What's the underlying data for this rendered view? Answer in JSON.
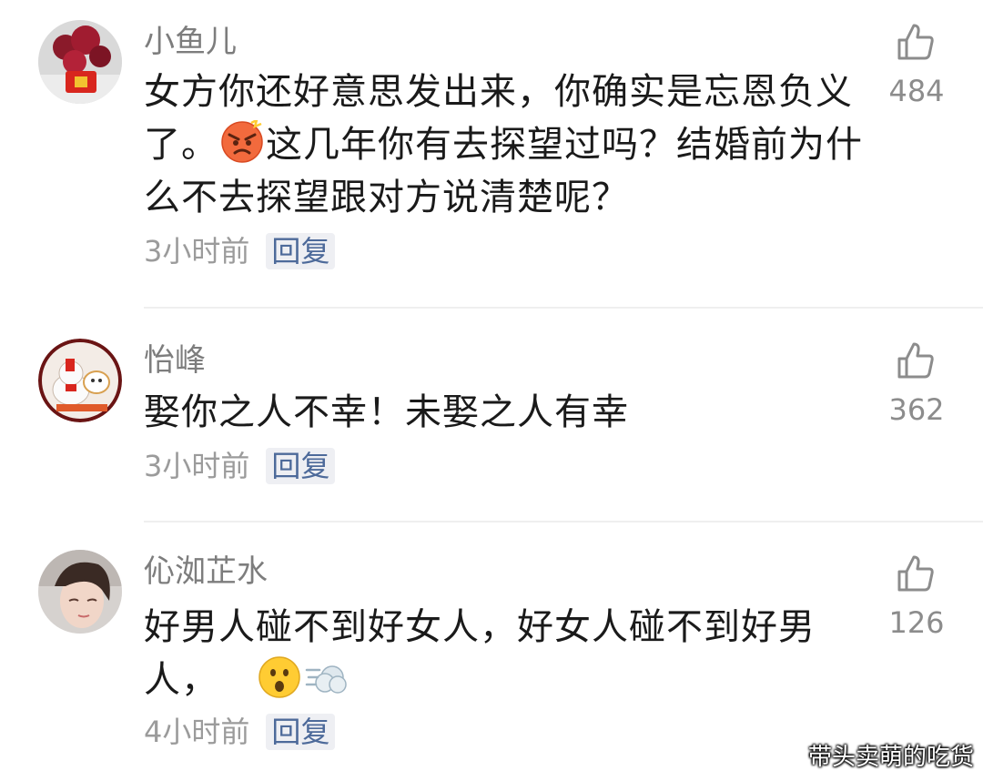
{
  "comments": [
    {
      "username": "小鱼儿",
      "content_a": "女方你还好意思发出来，你确实是忘恩负义了。",
      "emoji_a": "angry-face-emoji",
      "content_b": "这几年你有去探望过吗？结婚前为什么不去探望跟对方说清楚呢？",
      "time": "3小时前",
      "reply_label": "回复",
      "likes": "484"
    },
    {
      "username": "怡峰",
      "content_a": "娶你之人不幸！未娶之人有幸",
      "time": "3小时前",
      "reply_label": "回复",
      "likes": "362"
    },
    {
      "username": "伈洳芷水",
      "content_a": "好男人碰不到好女人，好女人碰不到好男人，",
      "emoji_a": "surprised-face-emoji",
      "emoji_b": "dash-emoji",
      "time": "4小时前",
      "reply_label": "回复",
      "likes": "126"
    }
  ],
  "watermark": "带头卖萌的吃货",
  "colors": {
    "text": "#1a1a1a",
    "username": "#7d7d7d",
    "meta": "#9b9b9b",
    "reply_text": "#4d6a9a",
    "reply_bg": "#eeeff3",
    "divider": "#efefef"
  }
}
